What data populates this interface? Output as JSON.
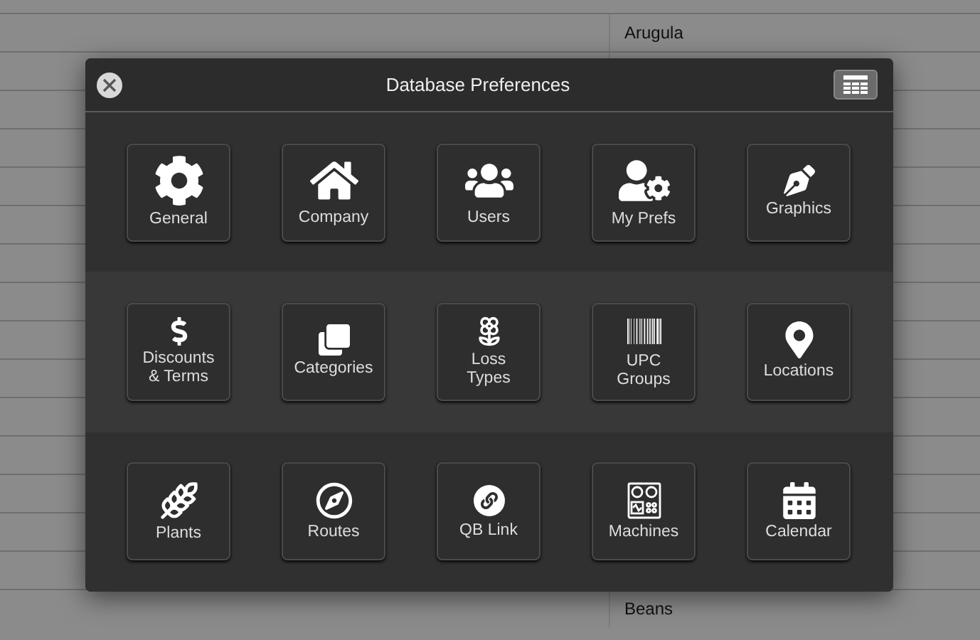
{
  "background_list": {
    "items": [
      "Arugula",
      "Beans"
    ]
  },
  "dialog": {
    "title": "Database Preferences",
    "sections": [
      {
        "items": [
          {
            "label": "General",
            "kind": "gear"
          },
          {
            "label": "Company",
            "kind": "house"
          },
          {
            "label": "Users",
            "kind": "users"
          },
          {
            "label": "My Prefs",
            "kind": "usergear"
          },
          {
            "label": "Graphics",
            "kind": "pen"
          }
        ]
      },
      {
        "items": [
          {
            "label": "Discounts\n& Terms",
            "kind": "dollar"
          },
          {
            "label": "Categories",
            "kind": "stack"
          },
          {
            "label": "Loss\nTypes",
            "kind": "flower"
          },
          {
            "label": "UPC\nGroups",
            "kind": "barcode"
          },
          {
            "label": "Locations",
            "kind": "pin"
          }
        ]
      },
      {
        "items": [
          {
            "label": "Plants",
            "kind": "wheat"
          },
          {
            "label": "Routes",
            "kind": "compass"
          },
          {
            "label": "QB Link",
            "kind": "link"
          },
          {
            "label": "Machines",
            "kind": "machine"
          },
          {
            "label": "Calendar",
            "kind": "calendar"
          }
        ]
      }
    ]
  }
}
